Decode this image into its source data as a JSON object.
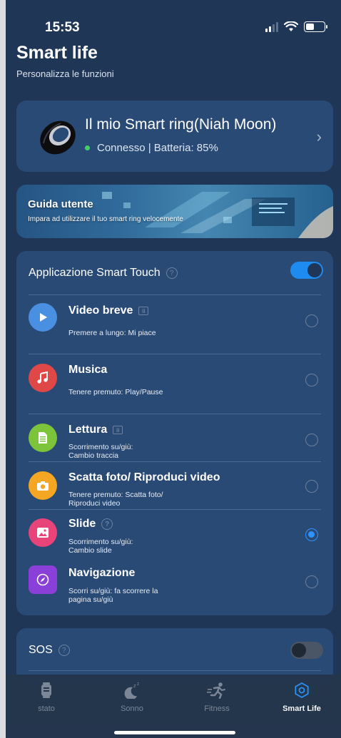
{
  "status_bar": {
    "time": "15:53"
  },
  "header": {
    "title": "Smart life",
    "subtitle": "Personalizza le funzioni"
  },
  "device": {
    "name": "Il mio Smart ring(Niah Moon)",
    "status": "Connesso | Batteria: 85%",
    "status_color": "#3fd06b"
  },
  "guide": {
    "title": "Guida utente",
    "subtitle": "Impara ad utilizzare il tuo smart ring velocemente"
  },
  "smart_touch": {
    "title": "Applicazione Smart Touch",
    "enabled": true,
    "items": [
      {
        "title": "Video breve",
        "desc": "Premere a lungo: Mi piace",
        "icon": "play-icon",
        "color": "#4a90e2",
        "selected": false
      },
      {
        "title": "Musica",
        "desc": "Tenere premuto: Play/Pause",
        "icon": "music-icon",
        "color": "#e04848",
        "selected": false
      },
      {
        "title": "Lettura",
        "desc": "Scorrimento su/giù:\nCambio traccia",
        "icon": "document-icon",
        "color": "#7cc43a",
        "selected": false
      },
      {
        "title": "Scatta foto/ Riproduci video",
        "desc": "Tenere premuto: Scatta foto/\nRiproduci video",
        "icon": "camera-icon",
        "color": "#f5a623",
        "selected": false
      },
      {
        "title": "Slide",
        "desc": "Scorrimento su/giù:\nCambio slide",
        "icon": "image-icon",
        "color": "#e8447a",
        "selected": true
      },
      {
        "title": "Navigazione",
        "desc": "Scorri su/giù: fa scorrere la\npagina su/giù",
        "icon": "compass-icon",
        "color": "#8a3fd8",
        "selected": false
      }
    ]
  },
  "sos": {
    "title": "SOS",
    "enabled": false
  },
  "tabs": [
    {
      "label": "stato",
      "icon": "watch-icon",
      "active": false
    },
    {
      "label": "Sonno",
      "icon": "sleep-icon",
      "active": false
    },
    {
      "label": "Fitness",
      "icon": "running-icon",
      "active": false
    },
    {
      "label": "Smart Life",
      "icon": "gear-icon",
      "active": true
    }
  ],
  "colors": {
    "background": "#1f3656",
    "card": "#2a4a76",
    "accent": "#1e8bf0"
  }
}
